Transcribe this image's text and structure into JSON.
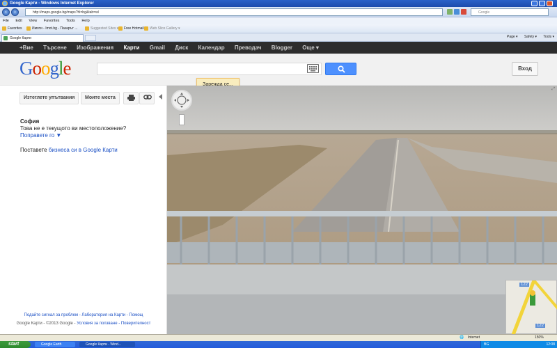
{
  "window": {
    "title": "Google Карти - Windows Internet Explorer",
    "address": "http://maps.google.bg/maps?hl=bg&tab=wl",
    "search_placeholder": "Google"
  },
  "ie_menu": [
    "File",
    "Edit",
    "View",
    "Favorites",
    "Tools",
    "Help"
  ],
  "favorites_bar": {
    "favorites_label": "Favorites",
    "items": [
      "Имоти - Imot.bg - Пазарът ...",
      "Suggested Sites ▾",
      "Free Hotmail",
      "Web Slice Gallery ▾"
    ]
  },
  "tab": {
    "label": "Google Карти"
  },
  "command_bar": [
    "Page ▾",
    "Safety ▾",
    "Tools ▾"
  ],
  "google_bar": {
    "items": [
      "+Вие",
      "Търсене",
      "Изображения",
      "Карти",
      "Gmail",
      "Диск",
      "Календар",
      "Преводач",
      "Blogger",
      "Още ▾"
    ],
    "active_index": 3
  },
  "header": {
    "logo_letters": [
      "G",
      "o",
      "o",
      "g",
      "l",
      "e"
    ],
    "logo_colors": [
      "#3366cc",
      "#cc2200",
      "#ffaa00",
      "#3366cc",
      "#339933",
      "#cc2200"
    ],
    "signin": "Вход"
  },
  "loading_text": "Зарежда се...",
  "left_panel": {
    "directions_button": "Изтеглете упътвания",
    "my_places_button": "Моите места",
    "city": "София",
    "not_location": "Това не е текущото ви местоположение?",
    "fix_link": "Поправете го ▼",
    "add_biz_prefix": "Поставете ",
    "add_biz_link": "бизнеса си в Google Карти",
    "footer_line1": "Подайте сигнал за проблем - Лаборатория на Карти - Помощ",
    "footer_line2_prefix": "Google Карти - ©2013 Google - ",
    "footer_line2_links": "Условия за ползване - Поверителност"
  },
  "street_view": {
    "minimap_road_label": "122"
  },
  "status_bar": {
    "zone": "Internet",
    "zoom": "150%"
  },
  "taskbar": {
    "start": "start",
    "tasks": [
      "Google Earth",
      "Google Карти - Wind..."
    ],
    "lang": "BG",
    "clock": "12:08"
  }
}
